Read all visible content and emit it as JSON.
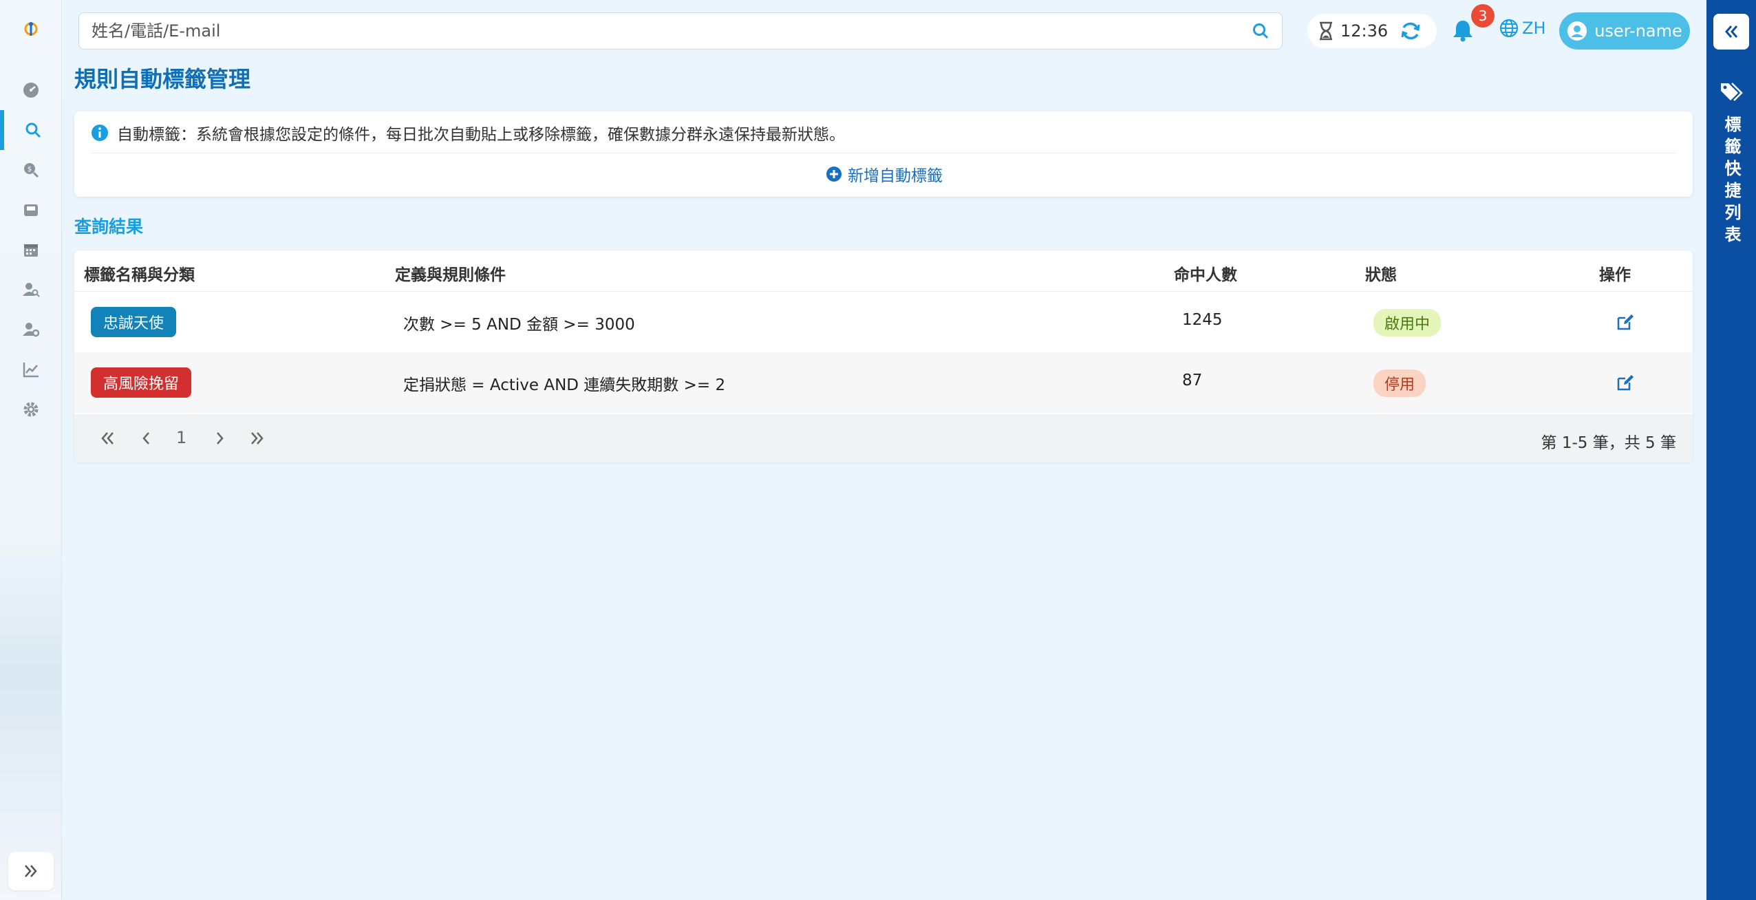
{
  "sidebar": {
    "items": [
      {
        "icon": "dashboard-icon"
      },
      {
        "icon": "search-icon",
        "active": true
      },
      {
        "icon": "dollar-search-icon"
      },
      {
        "icon": "inbox-icon"
      },
      {
        "icon": "calendar-icon"
      },
      {
        "icon": "user-search-icon"
      },
      {
        "icon": "user-settings-icon"
      },
      {
        "icon": "chart-line-icon"
      },
      {
        "icon": "gear-icon"
      }
    ]
  },
  "header": {
    "search_placeholder": "姓名/電話/E-mail",
    "timer": "12:36",
    "notification_count": "3",
    "lang": "ZH",
    "user": "user-name"
  },
  "right_panel": {
    "label": "標籤快捷列表"
  },
  "page": {
    "title": "規則自動標籤管理",
    "info": "自動標籤：系統會根據您設定的條件，每日批次自動貼上或移除標籤，確保數據分群永遠保持最新狀態。",
    "add_button": "新增自動標籤",
    "section_title": "查詢結果"
  },
  "table": {
    "headers": [
      "標籤名稱與分類",
      "定義與規則條件",
      "命中人數",
      "狀態",
      "操作"
    ],
    "rows": [
      {
        "tag": "忠誠天使",
        "tag_color": "#1183b8",
        "rule": "次數 >= 5 AND 金額 >= 3000",
        "hits": "1245",
        "status": "啟用中",
        "status_bg": "#e3f5b8",
        "status_color": "#4a7a12"
      },
      {
        "tag": "高風險挽留",
        "tag_color": "#d32f2f",
        "rule": "定捐狀態 = Active AND 連續失敗期數 >= 2",
        "hits": "87",
        "status": "停用",
        "status_bg": "#fbd3c3",
        "status_color": "#b43a1c"
      }
    ],
    "pager": {
      "page": "1",
      "summary": "第 1-5 筆，共 5 筆"
    }
  },
  "colors": {
    "accent": "#1a9ee0",
    "title": "#0f6eb6",
    "right_panel": "#0b4fa3"
  }
}
